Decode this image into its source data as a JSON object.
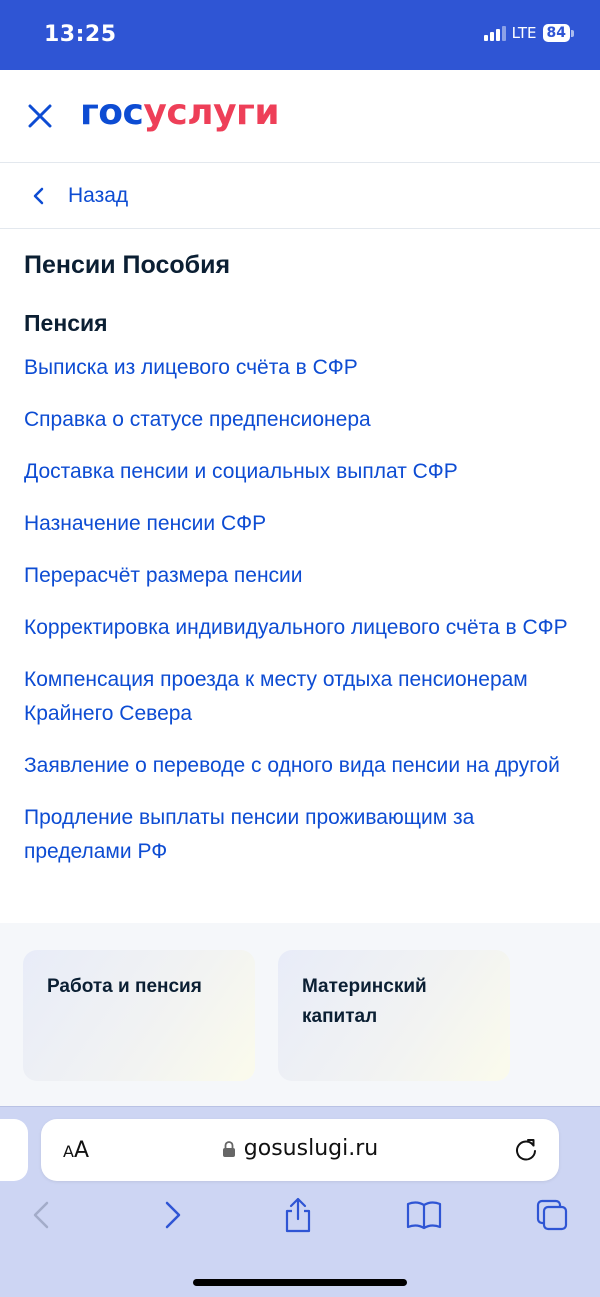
{
  "status_bar": {
    "time": "13:25",
    "network": "LTE",
    "battery": "84"
  },
  "header": {
    "logo_part1": "гос",
    "logo_part2": "услуги"
  },
  "nav": {
    "back_label": "Назад"
  },
  "page": {
    "title": "Пенсии Пособия",
    "section_title": "Пенсия",
    "links": [
      "Выписка из лицевого счёта в СФР",
      "Справка о статусе предпенсионера",
      "Доставка пенсии и социальных выплат СФР",
      "Назначение пенсии СФР",
      "Перерасчёт размера пенсии",
      "Корректировка индивидуального лицевого счёта в СФР",
      "Компенсация проезда к месту отдыха пенсионерам Крайнего Севера",
      "Заявление о переводе с одного вида пенсии на другой",
      "Продление выплаты пенсии проживающим за пределами РФ"
    ]
  },
  "cards": [
    {
      "label": "Работа и пенсия"
    },
    {
      "label": "Материнский капитал"
    }
  ],
  "browser": {
    "aa_label": "AA",
    "url": "gosuslugi.ru"
  },
  "colors": {
    "status_bar": "#2f55d4",
    "link": "#0d4cd3",
    "logo_blue": "#0d4cd3",
    "logo_red": "#ee3f58",
    "browser_bar": "#cdd5f3"
  },
  "icons": {
    "close": "close-icon",
    "back": "chevron-left-icon",
    "lock": "lock-icon",
    "reload": "reload-icon",
    "back_nav": "chevron-left-icon",
    "forward_nav": "chevron-right-icon",
    "share": "share-icon",
    "bookmarks": "book-icon",
    "tabs": "tabs-icon"
  }
}
